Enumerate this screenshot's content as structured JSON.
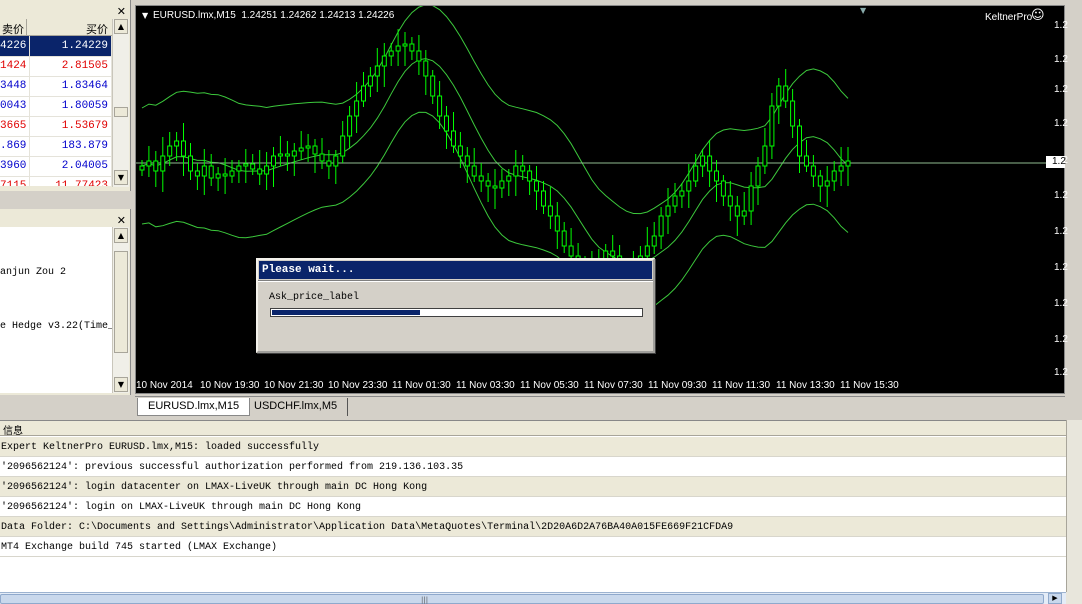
{
  "market_watch": {
    "col_bid": "卖价",
    "col_ask": "买价",
    "rows": [
      {
        "bid": "4226",
        "ask": "1.24229",
        "color": "#ffffff",
        "selected": true
      },
      {
        "bid": "1424",
        "ask": "2.81505",
        "color": "#e00000"
      },
      {
        "bid": "3448",
        "ask": "1.83464",
        "color": "#0000cc"
      },
      {
        "bid": "0043",
        "ask": "1.80059",
        "color": "#0000cc"
      },
      {
        "bid": "3665",
        "ask": "1.53679",
        "color": "#e00000"
      },
      {
        "bid": ".869",
        "ask": "183.879",
        "color": "#0000cc"
      },
      {
        "bid": "3960",
        "ask": "2.04005",
        "color": "#0000cc"
      },
      {
        "bid": "7115",
        "ask": "11.77423",
        "color": "#e00000"
      }
    ]
  },
  "navigator": {
    "lines": [
      "anjun Zou 2",
      "e Hedge v3.22(Time_i"
    ]
  },
  "chart": {
    "header": "EURUSD.lmx,M15  1.24251 1.24262 1.24213 1.24226",
    "expert_label": "KeltnerPro",
    "smiley_icon": "☺",
    "price_labels": [
      "1.2",
      "1.2",
      "1.2",
      "1.2",
      "1.2",
      "1.2",
      "1.2",
      "1.2",
      "1.2",
      "1.2",
      "1.2"
    ],
    "time_labels": [
      "10 Nov 2014",
      "10 Nov 19:30",
      "10 Nov 21:30",
      "10 Nov 23:30",
      "11 Nov 01:30",
      "11 Nov 03:30",
      "11 Nov 05:30",
      "11 Nov 07:30",
      "11 Nov 09:30",
      "11 Nov 11:30",
      "11 Nov 13:30",
      "11 Nov 15:30"
    ],
    "current_price_label": "1.2",
    "colors": {
      "background": "#000000",
      "candles": "#00ff00",
      "bands": "#3cc83c",
      "price_line": "#8fbc8f"
    }
  },
  "chart_tabs": [
    "EURUSD.lmx,M15",
    "USDCHF.lmx,M5"
  ],
  "dialog": {
    "title": "Please wait...",
    "label": "Ask_price_label",
    "progress": 0.4,
    "title_color": "#0a246a",
    "bar_color": "#0a246a"
  },
  "terminal": {
    "header": "信息",
    "rows": [
      "Expert KeltnerPro EURUSD.lmx,M15: loaded successfully",
      "'2096562124': previous successful authorization performed from 219.136.103.35",
      "'2096562124': login datacenter on LMAX-LiveUK through main DC Hong Kong",
      "'2096562124': login on LMAX-LiveUK through main DC Hong Kong",
      "Data Folder: C:\\Documents and Settings\\Administrator\\Application Data\\MetaQuotes\\Terminal\\2D20A6D2A76BA40A015FE669F21CFDA9",
      "MT4 Exchange build 745 started (LMAX Exchange)"
    ]
  },
  "icons": [
    "close-icon",
    "scroll-up-icon",
    "scroll-down-icon",
    "smiley-icon",
    "chart-menu-triangle-icon"
  ]
}
